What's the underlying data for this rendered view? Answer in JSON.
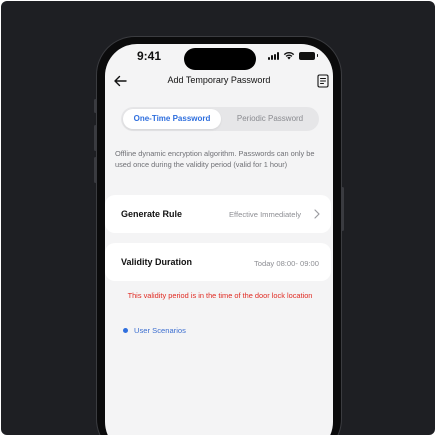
{
  "status_bar": {
    "time": "9:41"
  },
  "header": {
    "title": "Add Temporary Password"
  },
  "tabs": [
    {
      "label": "One-Time Password",
      "active": true
    },
    {
      "label": "Periodic Password",
      "active": false
    }
  ],
  "description": "Offline dynamic encryption algorithm. Passwords can only be used once during the validity period (valid for 1 hour)",
  "generate_rule": {
    "label": "Generate Rule",
    "value": "Effective Immediately"
  },
  "validity": {
    "label": "Validity Duration",
    "value": "Today 08:00- 09:00"
  },
  "warning": "This validity period is in the time of the door lock location",
  "scenarios_link": "User Scenarios",
  "colors": {
    "accent": "#2f6fde",
    "warning": "#e02a22",
    "background": "#f4f4f5"
  }
}
